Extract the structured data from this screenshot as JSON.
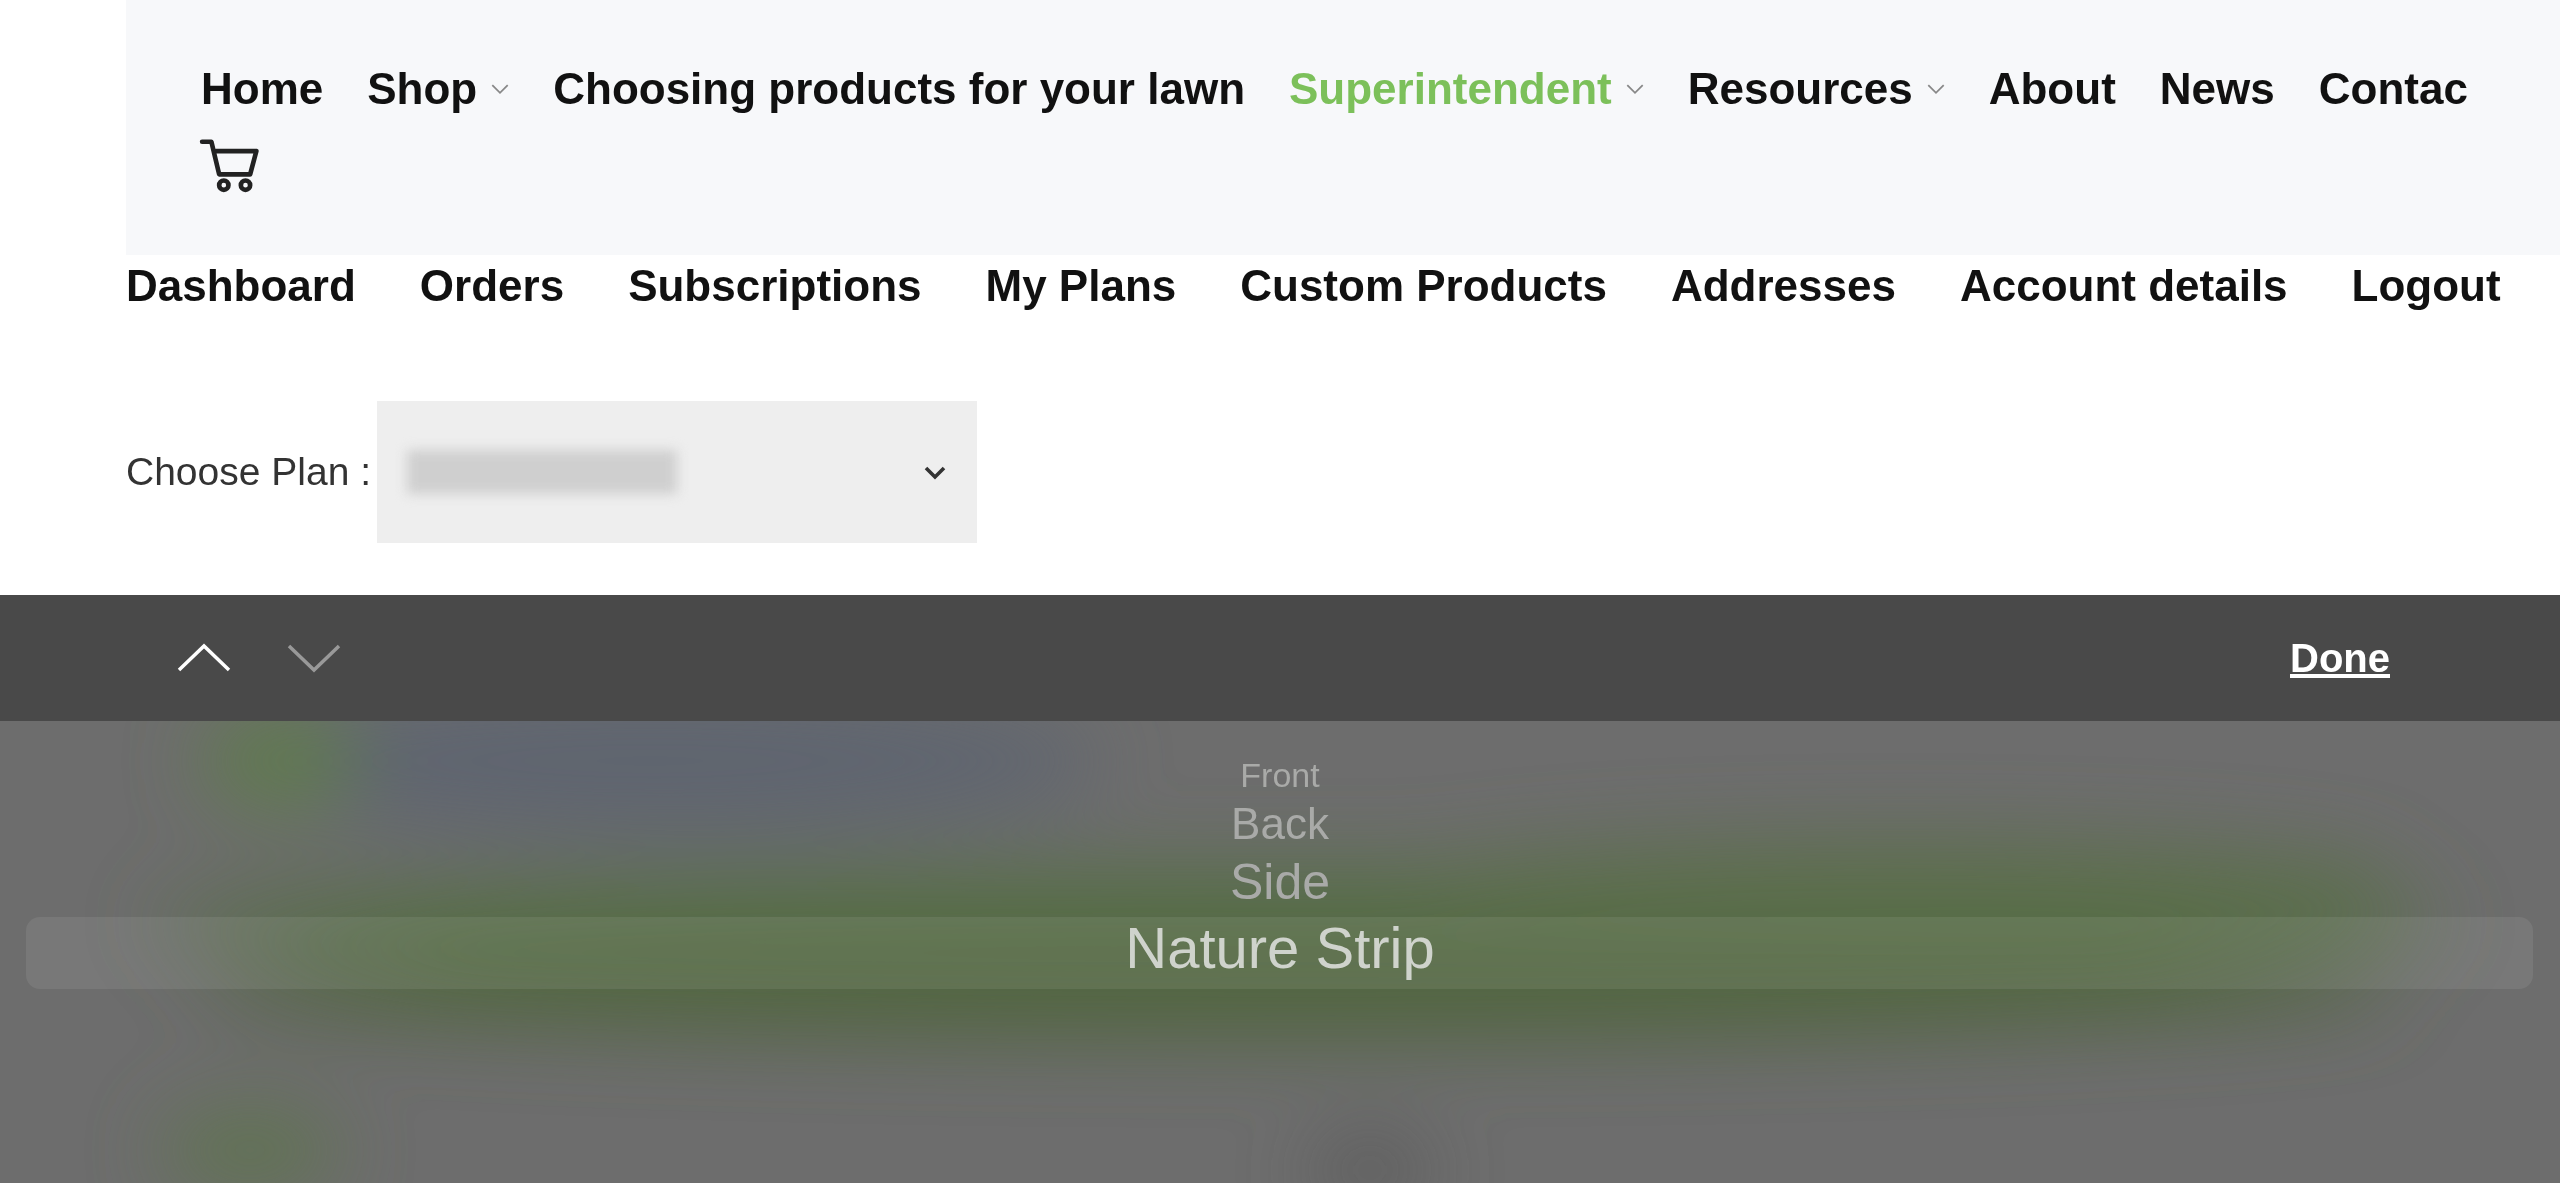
{
  "main_nav": [
    {
      "label": "Home",
      "dropdown": false,
      "selected": false
    },
    {
      "label": "Shop",
      "dropdown": true,
      "selected": false
    },
    {
      "label": "Choosing products for your lawn",
      "dropdown": false,
      "selected": false
    },
    {
      "label": "Superintendent",
      "dropdown": true,
      "selected": true
    },
    {
      "label": "Resources",
      "dropdown": true,
      "selected": false
    },
    {
      "label": "About",
      "dropdown": false,
      "selected": false
    },
    {
      "label": "News",
      "dropdown": false,
      "selected": false
    },
    {
      "label": "Contac",
      "dropdown": false,
      "selected": false
    }
  ],
  "account_nav": [
    "Dashboard",
    "Orders",
    "Subscriptions",
    "My Plans",
    "Custom Products",
    "Addresses",
    "Account details",
    "Logout"
  ],
  "plan_select": {
    "label": "Choose Plan :"
  },
  "picker_toolbar": {
    "done": "Done"
  },
  "picker_options": [
    {
      "label": "Front",
      "selected": false
    },
    {
      "label": "Back",
      "selected": false
    },
    {
      "label": "Side",
      "selected": false
    },
    {
      "label": "Nature Strip",
      "selected": true
    }
  ]
}
